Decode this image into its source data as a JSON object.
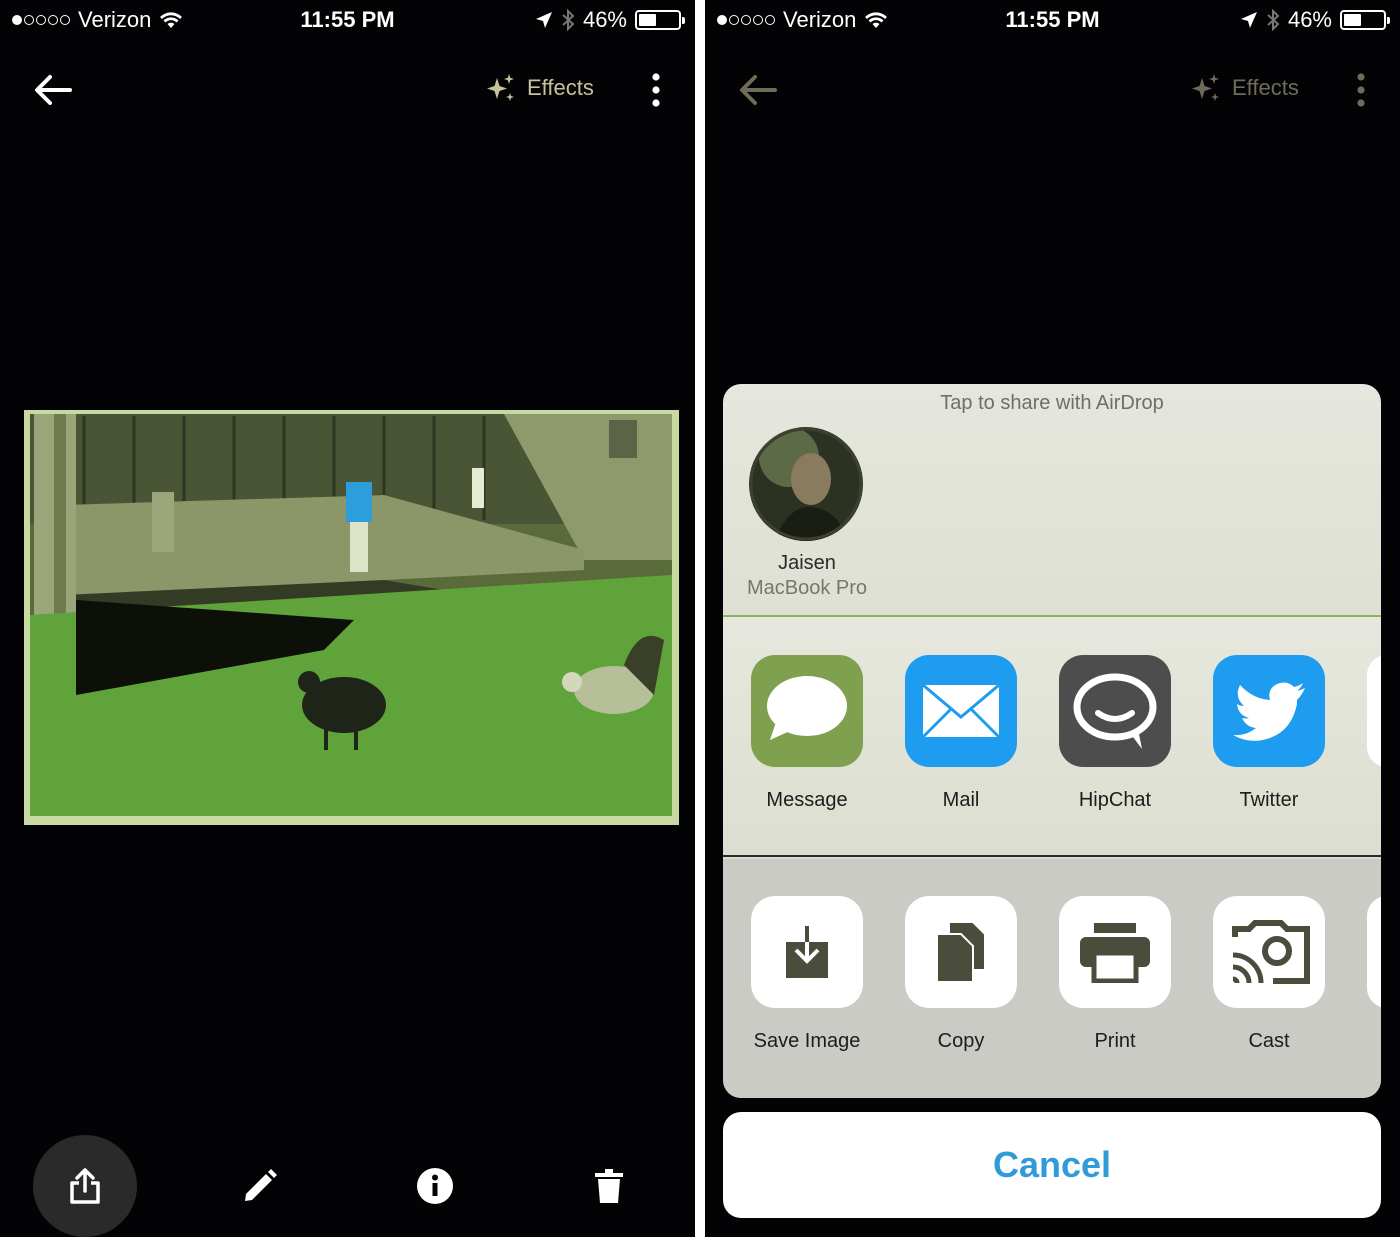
{
  "status": {
    "carrier": "Verizon",
    "time": "11:55 PM",
    "battery": "46%",
    "battery_fraction": 0.46
  },
  "toolbar": {
    "effects_label": "Effects"
  },
  "bottom_bar": {
    "icons": [
      "share-icon",
      "edit-pencil-icon",
      "info-icon",
      "trash-icon"
    ]
  },
  "share_sheet": {
    "airdrop_title": "Tap to share with AirDrop",
    "contact": {
      "name": "Jaisen",
      "device": "MacBook Pro"
    },
    "apps": [
      {
        "label": "Message",
        "icon": "message-bubble-icon",
        "color": "#7fa04e"
      },
      {
        "label": "Mail",
        "icon": "mail-envelope-icon",
        "color": "#1e9cf0"
      },
      {
        "label": "HipChat",
        "icon": "hipchat-bubble-icon",
        "color": "#4d4d4d"
      },
      {
        "label": "Twitter",
        "icon": "twitter-bird-icon",
        "color": "#1e9cf0"
      }
    ],
    "actions": [
      {
        "label": "Save Image",
        "icon": "save-image-icon"
      },
      {
        "label": "Copy",
        "icon": "copy-icon"
      },
      {
        "label": "Print",
        "icon": "print-icon"
      },
      {
        "label": "Cast",
        "icon": "cast-icon"
      }
    ],
    "cancel_label": "Cancel"
  },
  "colors": {
    "background": "#030306",
    "effects_text": "#c7c29b",
    "cancel_text": "#2f9bd9"
  }
}
